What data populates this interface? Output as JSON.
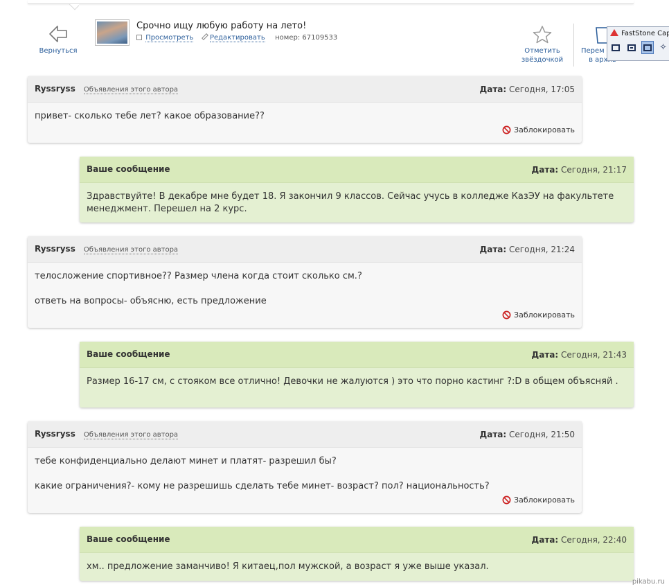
{
  "header": {
    "back_label": "Вернуться",
    "ad_title": "Срочно ищу любую работу на лето!",
    "view_label": "Просмотреть",
    "edit_label": "Редактировать",
    "number_text": "номер: 67109533",
    "star_label_1": "Отметить",
    "star_label_2": "звёздочкой",
    "archive_label_1": "Перем",
    "archive_label_2": "в архив"
  },
  "faststone": {
    "title": "FastStone Cap"
  },
  "common": {
    "author_ads_link": "Объявления этого автора",
    "date_label": "Дата:",
    "block_label": "Заблокировать"
  },
  "messages": [
    {
      "type": "theirs",
      "author": "Ryssryss",
      "date": "Сегодня, 17:05",
      "lines": [
        "привет- сколько тебе лет? какое образование??"
      ]
    },
    {
      "type": "mine",
      "author": "Ваше сообщение",
      "date": "Сегодня, 21:17",
      "lines": [
        "Здравствуйте! В декабре мне будет 18. Я закончил 9 классов. Сейчас учусь в колледже КазЭУ на факультете менеджмент. Перешел на 2 курс."
      ]
    },
    {
      "type": "theirs",
      "author": "Ryssryss",
      "date": "Сегодня, 21:24",
      "lines": [
        "телосложение спортивное?? Размер члена когда стоит сколько см.?",
        "ответь на вопросы- объясню, есть предложение"
      ]
    },
    {
      "type": "mine",
      "author": "Ваше сообщение",
      "date": "Сегодня, 21:43",
      "lines": [
        "Размер 16-17 см, с стояком все отлично! Девочки не жалуются ) это что порно кастинг ?:D в общем объясняй ."
      ]
    },
    {
      "type": "theirs",
      "author": "Ryssryss",
      "date": "Сегодня, 21:50",
      "lines": [
        "тебе конфиденциально делают минет и платят- разрешил бы?",
        "какие ограничения?- кому не разрешишь сделать тебе минет- возраст? пол? национальность?"
      ]
    },
    {
      "type": "mine",
      "author": "Ваше сообщение",
      "date": "Сегодня, 22:40",
      "lines": [
        "хм.. предложение заманчиво! Я китаец,пол мужской, а возраст я уже выше указал."
      ]
    }
  ],
  "watermark": "pikabu.ru",
  "colors": {
    "link": "#2a5d9a",
    "mine_bg": "#e4f0d2",
    "theirs_bg": "#f7f7f7",
    "block_icon": "#cc2222"
  }
}
